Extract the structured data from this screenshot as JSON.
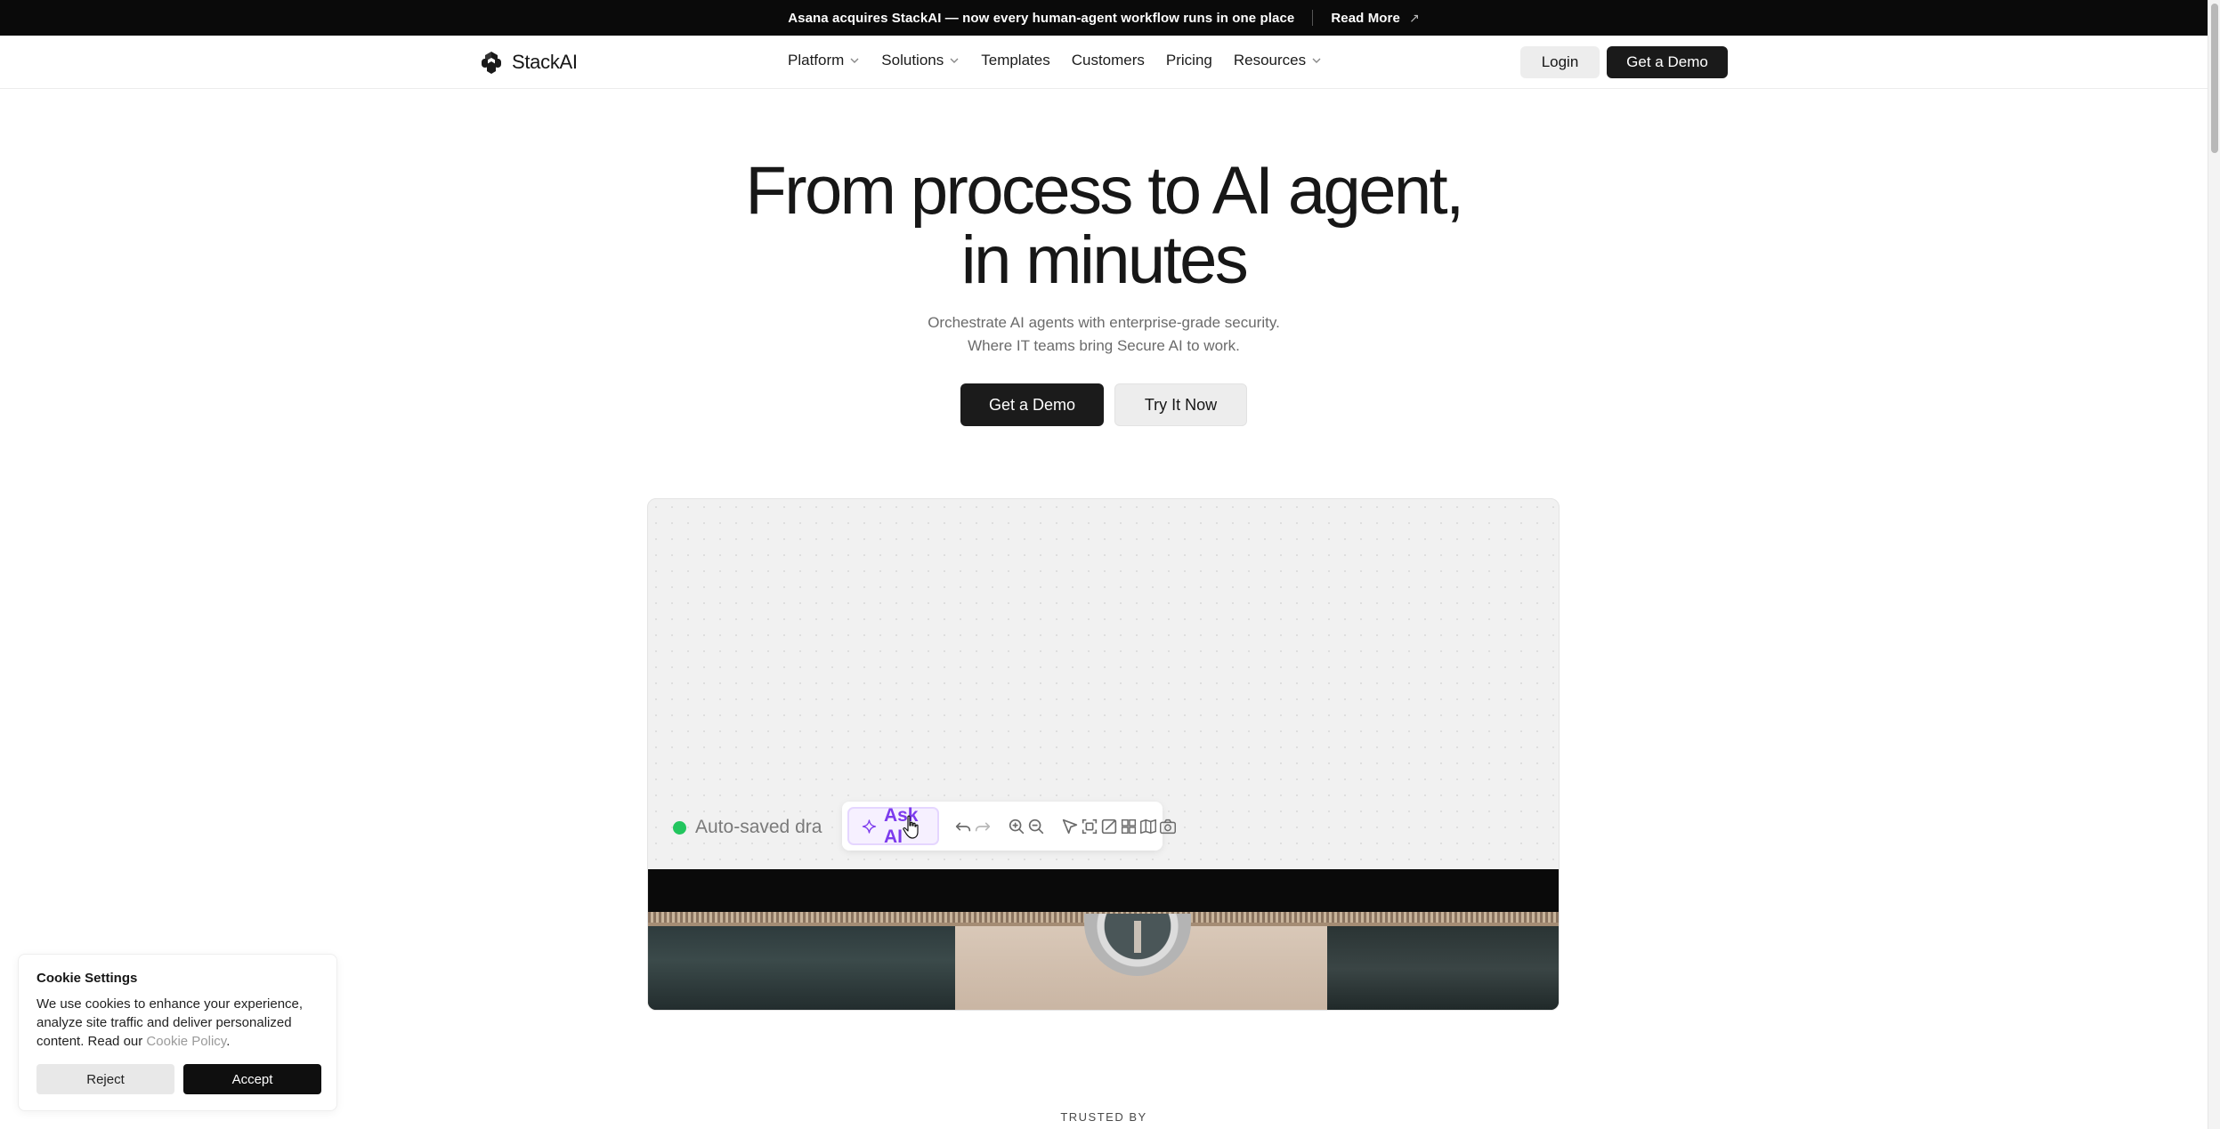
{
  "announcement": {
    "text": "Asana acquires StackAI — now every human-agent workflow runs in one place",
    "link_label": "Read More",
    "arrow": "↗"
  },
  "nav": {
    "logo_text": "StackAI",
    "items": [
      {
        "label": "Platform",
        "has_dropdown": true
      },
      {
        "label": "Solutions",
        "has_dropdown": true
      },
      {
        "label": "Templates",
        "has_dropdown": false
      },
      {
        "label": "Customers",
        "has_dropdown": false
      },
      {
        "label": "Pricing",
        "has_dropdown": false
      },
      {
        "label": "Resources",
        "has_dropdown": true
      }
    ],
    "login_label": "Login",
    "demo_label": "Get a Demo"
  },
  "hero": {
    "title_line1": "From process to AI agent,",
    "title_line2": "in minutes",
    "subtitle_line1": "Orchestrate AI agents with enterprise-grade security.",
    "subtitle_line2": "Where IT teams bring Secure AI to work.",
    "primary_cta": "Get a Demo",
    "secondary_cta": "Try It Now"
  },
  "preview": {
    "autosave_text": "Auto-saved dra",
    "autosave_status_color": "#22c55e",
    "ask_ai_label": "Ask AI",
    "tools": [
      "undo-icon",
      "redo-icon",
      "zoom-in-icon",
      "zoom-out-icon",
      "pointer-icon",
      "fit-view-icon",
      "edit-icon",
      "layout-icon",
      "map-icon",
      "camera-icon"
    ]
  },
  "cookie": {
    "title": "Cookie Settings",
    "body": "We use cookies to enhance your experience, analyze site traffic and deliver personalized content. Read our ",
    "link": "Cookie Policy",
    "suffix": ".",
    "reject_label": "Reject",
    "accept_label": "Accept"
  },
  "trusted_label": "TRUSTED BY",
  "colors": {
    "accent_purple": "#7c3aed",
    "dark": "#1b1b1b"
  }
}
